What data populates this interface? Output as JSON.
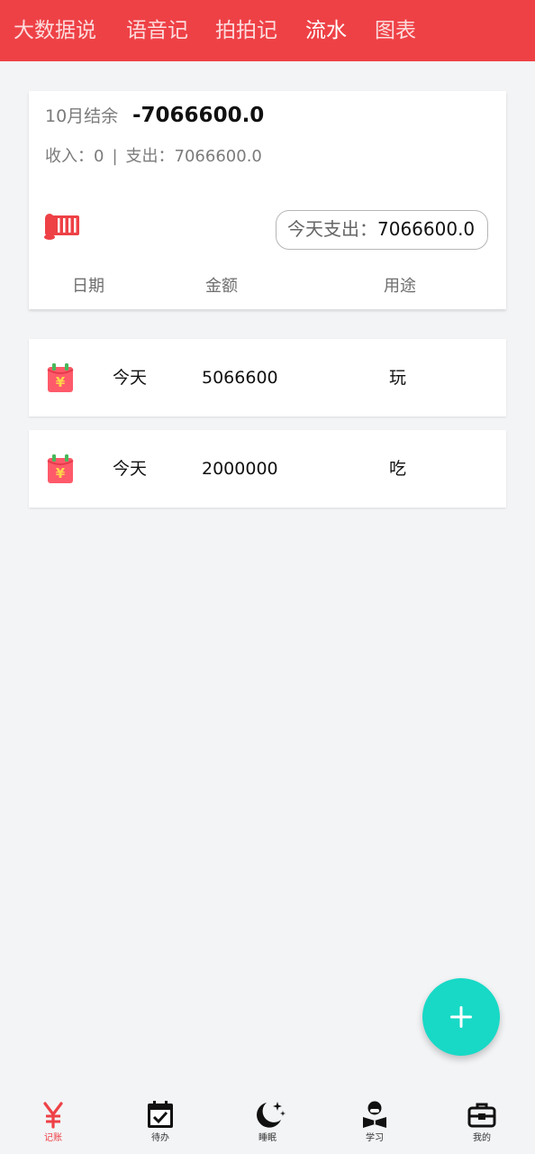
{
  "colors": {
    "accent": "#ee4146",
    "fab": "#17d9c6",
    "background": "#f3f4f6"
  },
  "top_tabs": [
    {
      "label": "大数据说",
      "active": false
    },
    {
      "label": "语音记",
      "active": false
    },
    {
      "label": "拍拍记",
      "active": false
    },
    {
      "label": "流水",
      "active": true
    },
    {
      "label": "图表",
      "active": false
    }
  ],
  "summary": {
    "month_label": "10月结余",
    "month_balance": "-7066600.0",
    "income_label": "收入：",
    "income_value": "0",
    "separator": "|",
    "expense_label": "支出：",
    "expense_value": "7066600.0",
    "today_label": "今天支出：",
    "today_value": "7066600.0",
    "icon": "scroll-icon"
  },
  "columns": {
    "date": "日期",
    "amount": "金额",
    "purpose": "用途"
  },
  "records": [
    {
      "icon": "red-envelope-icon",
      "date": "今天",
      "amount": "5066600",
      "purpose": "玩"
    },
    {
      "icon": "red-envelope-icon",
      "date": "今天",
      "amount": "2000000",
      "purpose": "吃"
    }
  ],
  "fab": {
    "icon": "plus-icon"
  },
  "bottom_nav": [
    {
      "label": "记账",
      "icon": "yen-icon",
      "active": true
    },
    {
      "label": "待办",
      "icon": "calendar-check-icon",
      "active": false
    },
    {
      "label": "睡眠",
      "icon": "moon-stars-icon",
      "active": false
    },
    {
      "label": "学习",
      "icon": "reader-icon",
      "active": false
    },
    {
      "label": "我的",
      "icon": "toolbox-icon",
      "active": false
    }
  ]
}
